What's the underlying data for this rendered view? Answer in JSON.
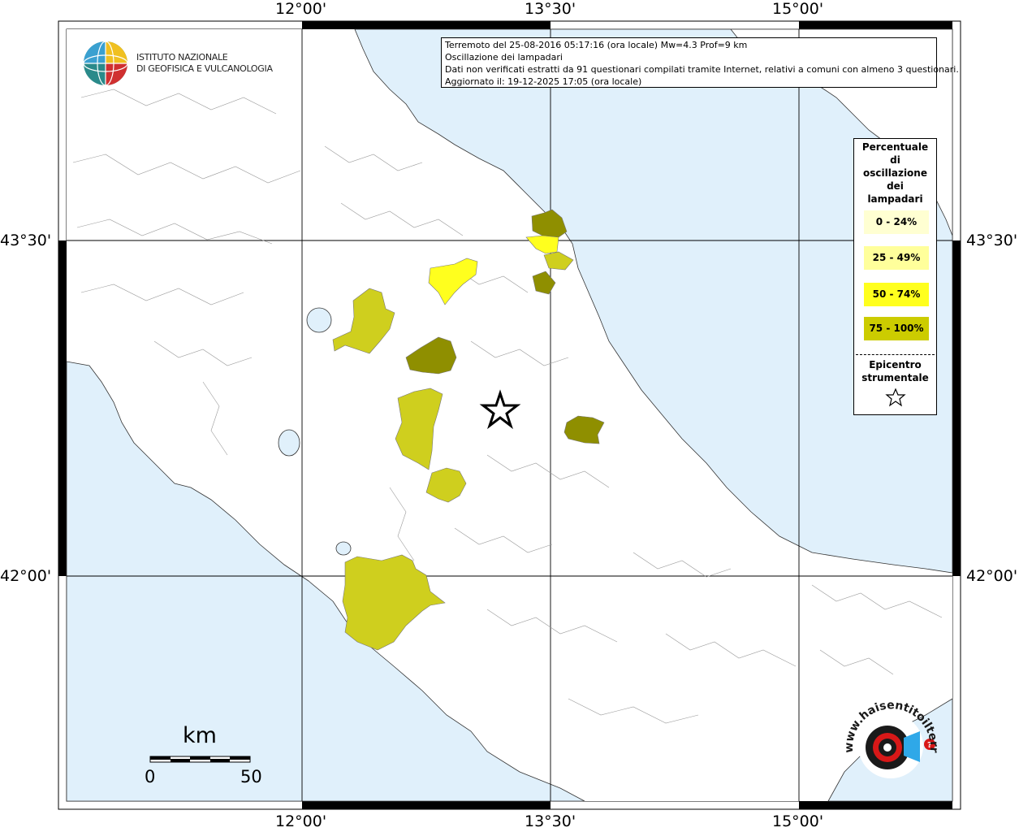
{
  "info_box": {
    "line1": "Terremoto del 25-08-2016 05:17:16 (ora locale) Mw=4.3 Prof=9 km",
    "line2": "Oscillazione dei lampadari",
    "line3": "Dati non verificati estratti da 91 questionari compilati tramite Internet, relativi a comuni con almeno 3 questionari.",
    "line4": "Aggiornato il: 19-12-2025 17:05 (ora locale)"
  },
  "axes": {
    "lon_top": [
      "12°00'",
      "13°30'",
      "15°00'"
    ],
    "lon_bottom": [
      "12°00'",
      "13°30'",
      "15°00'"
    ],
    "lat_left": [
      "43°30'",
      "42°00'"
    ],
    "lat_right": [
      "43°30'",
      "42°00'"
    ]
  },
  "legend": {
    "title_lines": [
      "Percentuale",
      "di",
      "oscillazione",
      "dei",
      "lampadari"
    ],
    "classes": [
      {
        "label": "0 - 24%",
        "color": "#ffffd2"
      },
      {
        "label": "25 - 49%",
        "color": "#ffff9b"
      },
      {
        "label": "50 - 74%",
        "color": "#ffff1e"
      },
      {
        "label": "75 - 100%",
        "color": "#cccc00"
      }
    ],
    "epicenter_lines": [
      "Epicentro",
      "strumentale"
    ]
  },
  "logo": {
    "line1": "ISTITUTO NAZIONALE",
    "line2": "DI GEOFISICA E VULCANOLOGIA"
  },
  "scale_bar": {
    "title": "km",
    "min": "0",
    "max": "50"
  },
  "badge": {
    "text": "www.haisentitoilterremoto.it"
  },
  "colors": {
    "sea": "#e0f0fb",
    "land": "#ffffff",
    "class_olive": "#8f8f00",
    "class_yellow_green": "#cfcf1e"
  }
}
